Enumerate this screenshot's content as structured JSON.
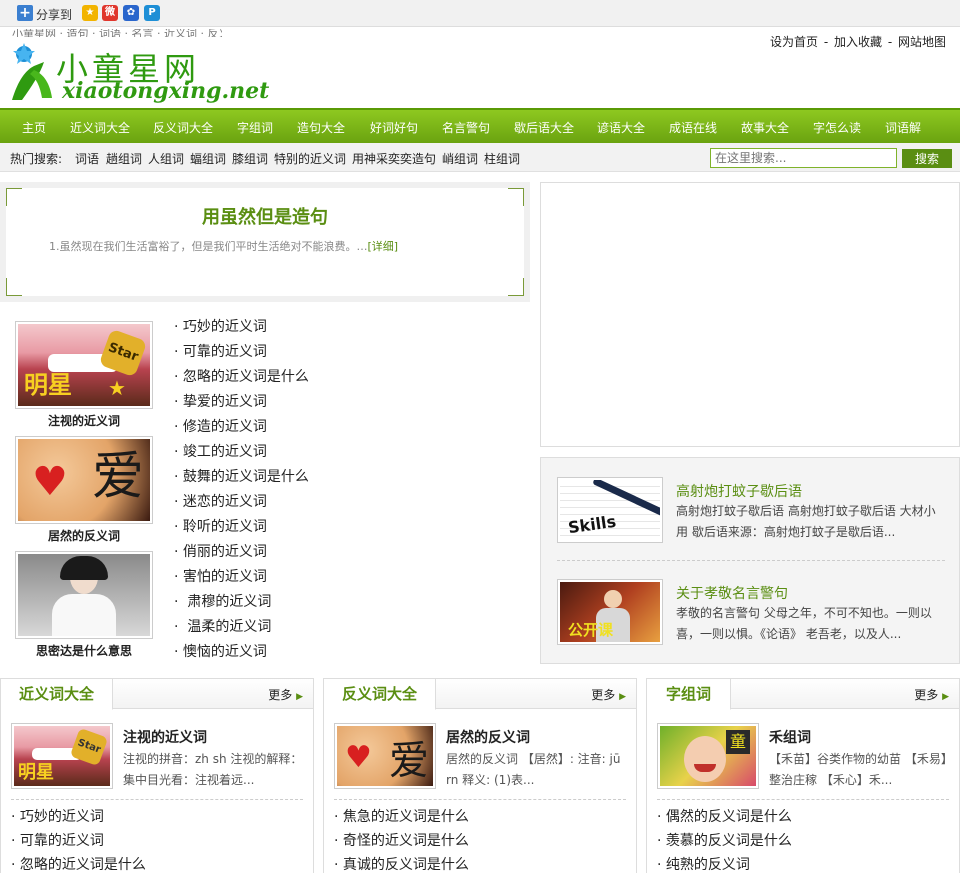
{
  "share": {
    "label": "分享到"
  },
  "header": {
    "top_text": "小童星网 · 造句 · 词语 · 名言 · 近义词 · 反义词",
    "logo_cn": "小童星网",
    "logo_en": "xiaotongxing.net",
    "links": [
      "设为首页",
      "加入收藏",
      "网站地图"
    ]
  },
  "nav": [
    "主页",
    "近义词大全",
    "反义词大全",
    "字组词",
    "造句大全",
    "好词好句",
    "名言警句",
    "歇后语大全",
    "谚语大全",
    "成语在线",
    "故事大全",
    "字怎么读",
    "词语解"
  ],
  "hot": {
    "label": "热门搜索:",
    "items": [
      "词语",
      "趟组词",
      "人组词",
      "蝠组词",
      "膝组词",
      "特别的近义词",
      "用神采奕奕造句",
      "峭组词",
      "柱组词"
    ]
  },
  "search": {
    "placeholder": "在这里搜索...",
    "button": "搜索"
  },
  "featured": {
    "title": "用虽然但是造句",
    "text": "1.虽然现在我们生活富裕了，但是我们平时生活绝对不能浪费。…",
    "more": "[详细]"
  },
  "thumbs": [
    {
      "caption": "注视的近义词",
      "word": "明星"
    },
    {
      "caption": "居然的反义词",
      "word": "爱"
    },
    {
      "caption": "思密达是什么意思",
      "word": ""
    }
  ],
  "side_list": [
    "巧妙的近义词",
    "可靠的近义词",
    "忽略的近义词是什么",
    "挚爱的近义词",
    "修造的近义词",
    "竣工的近义词",
    "鼓舞的近义词是什么",
    "迷恋的近义词",
    "聆听的近义词",
    "俏丽的近义词",
    "害怕的近义词",
    " 肃穆的近义词",
    " 温柔的近义词",
    "懊恼的近义词"
  ],
  "news": [
    {
      "title": "高射炮打蚊子歇后语",
      "desc": "高射炮打蚊子歇后语 高射炮打蚊子歇后语 大材小用 歇后语来源：高射炮打蚊子是歇后语...",
      "img_word": "Skills"
    },
    {
      "title": "关于孝敬名言警句",
      "desc": "孝敬的名言警句 父母之年，不可不知也。一则以喜，一则以惧。《论语》 老吾老，以及人...",
      "img_word": "公开课"
    }
  ],
  "columns": [
    {
      "tab": "近义词大全",
      "more": "更多",
      "title": "注视的近义词",
      "desc": "注视的拼音：zh sh 注视的解释：集中目光看：注视着远...",
      "list": [
        "巧妙的近义词",
        "可靠的近义词",
        "忽略的近义词是什么"
      ]
    },
    {
      "tab": "反义词大全",
      "more": "更多",
      "title": "居然的反义词",
      "desc": "居然的反义词 【居然】: 注音: jū rn 释义: (1)表...",
      "list": [
        "焦急的近义词是什么",
        "奇怪的近义词是什么",
        "真诚的反义词是什么"
      ]
    },
    {
      "tab": "字组词",
      "more": "更多",
      "title": "禾组词",
      "desc": "【禾苗】谷类作物的幼苗 【禾易】整治庄稼 【禾心】禾...",
      "list": [
        "偶然的反义词是什么",
        "羡慕的反义词是什么",
        "纯熟的反义词"
      ]
    }
  ],
  "colors": {
    "brand_green": "#5a8e12",
    "nav_green": "#7cb518"
  }
}
